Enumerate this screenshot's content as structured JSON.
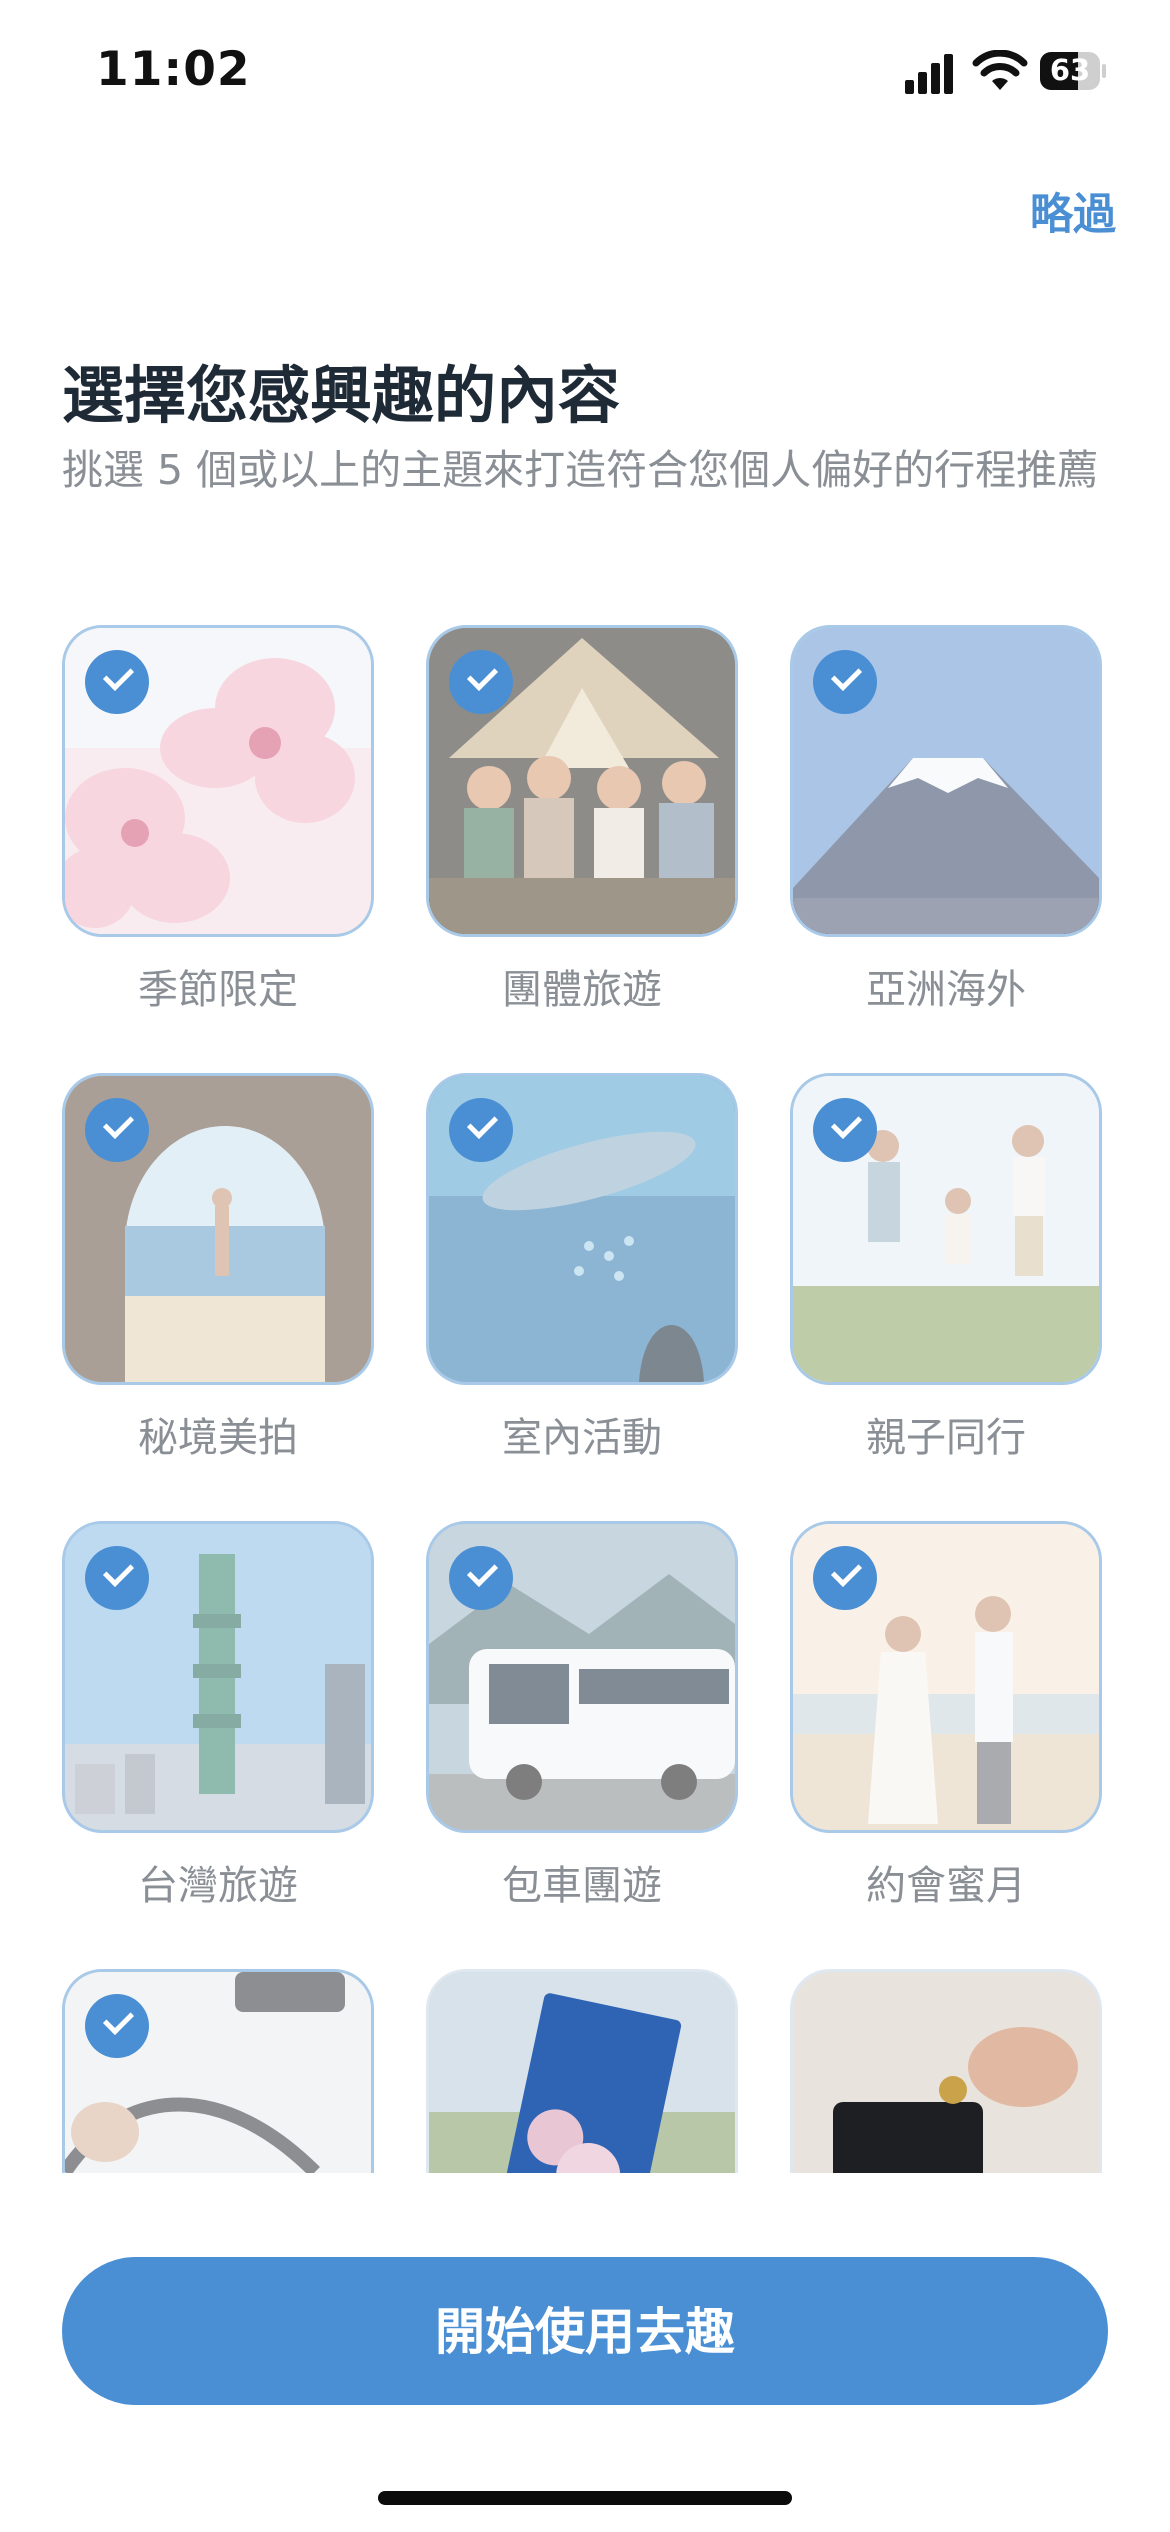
{
  "status_bar": {
    "time": "11:02",
    "battery_percent": "63",
    "battery_level": 0.63
  },
  "header": {
    "skip_label": "略過",
    "title": "選擇您感興趣的內容",
    "subtitle": "挑選 5 個或以上的主題來打造符合您個人偏好的行程推薦"
  },
  "topics": [
    {
      "label": "季節限定",
      "selected": true,
      "image": "cherry-blossom"
    },
    {
      "label": "團體旅遊",
      "selected": true,
      "image": "camping-friends"
    },
    {
      "label": "亞洲海外",
      "selected": true,
      "image": "mount-fuji"
    },
    {
      "label": "秘境美拍",
      "selected": true,
      "image": "sea-cave"
    },
    {
      "label": "室內活動",
      "selected": true,
      "image": "aquarium"
    },
    {
      "label": "親子同行",
      "selected": true,
      "image": "family-jump"
    },
    {
      "label": "台灣旅遊",
      "selected": true,
      "image": "taipei-101"
    },
    {
      "label": "包車團遊",
      "selected": true,
      "image": "tour-bus"
    },
    {
      "label": "約會蜜月",
      "selected": true,
      "image": "couple-dance"
    },
    {
      "label": "",
      "selected": true,
      "image": "car-driving"
    },
    {
      "label": "",
      "selected": false,
      "image": "rail-pass"
    },
    {
      "label": "",
      "selected": false,
      "image": "coin-wallet"
    }
  ],
  "footer": {
    "cta_label": "開始使用去趣"
  },
  "colors": {
    "accent": "#4a8fd4",
    "selected_border": "#a9c9e8",
    "muted_text": "#8a8f96"
  }
}
